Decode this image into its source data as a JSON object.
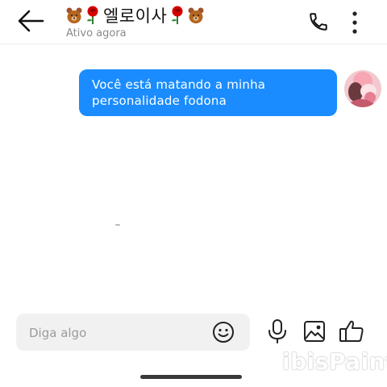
{
  "header": {
    "contact_name": "엘로이사",
    "status": "Ativo agora",
    "decorations": [
      "teddy-bear-icon",
      "rose-icon",
      "rose-icon",
      "teddy-bear-icon"
    ]
  },
  "messages": [
    {
      "direction": "outgoing",
      "text": "Você está matando a minha personalidade fodona",
      "bubble_color": "#1a8cff"
    }
  ],
  "composer": {
    "placeholder": "Diga algo"
  },
  "icons": {
    "back": "back-arrow-icon",
    "call": "phone-icon",
    "more": "more-vert-icon",
    "emoji": "emoji-icon",
    "mic": "mic-icon",
    "image": "image-icon",
    "like": "thumbs-up-icon"
  },
  "watermark": "ibisPaint",
  "colors": {
    "accent": "#1a8cff",
    "input_bg": "#f1f1f1",
    "status_text": "#8a8a8a"
  }
}
